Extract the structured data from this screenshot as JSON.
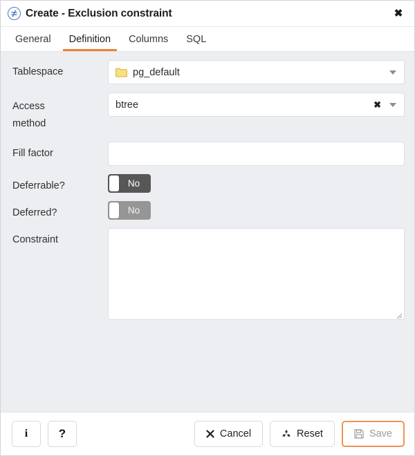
{
  "window": {
    "title": "Create - Exclusion constraint",
    "title_icon": "exclusion-constraint-icon",
    "close_label": "✖"
  },
  "tabs": [
    {
      "label": "General",
      "active": false
    },
    {
      "label": "Definition",
      "active": true
    },
    {
      "label": "Columns",
      "active": false
    },
    {
      "label": "SQL",
      "active": false
    }
  ],
  "form": {
    "tablespace": {
      "label": "Tablespace",
      "value": "pg_default",
      "icon": "folder-icon",
      "caret": "chevron-down-icon"
    },
    "access_method": {
      "label": "Access method",
      "label_line1": "Access",
      "label_line2": "method",
      "value": "btree",
      "clear": "✖",
      "caret": "chevron-down-icon"
    },
    "fill_factor": {
      "label": "Fill factor",
      "value": "",
      "placeholder": ""
    },
    "deferrable": {
      "label": "Deferrable?",
      "value": "No",
      "state": "enabled"
    },
    "deferred": {
      "label": "Deferred?",
      "value": "No",
      "state": "disabled"
    },
    "constraint": {
      "label": "Constraint",
      "value": "",
      "placeholder": ""
    }
  },
  "footer": {
    "info_label": "i",
    "help_label": "?",
    "cancel_label": "Cancel",
    "cancel_icon": "cross-icon",
    "reset_label": "Reset",
    "reset_icon": "recycle-icon",
    "save_label": "Save",
    "save_icon": "floppy-disk-icon"
  },
  "colors": {
    "accent": "#ef8030",
    "body_bg": "#eceef2",
    "toggle_enabled": "#575757",
    "toggle_disabled": "#969696",
    "title_icon_blue": "#4a79c4",
    "folder_yellow": "#f6de7d"
  }
}
